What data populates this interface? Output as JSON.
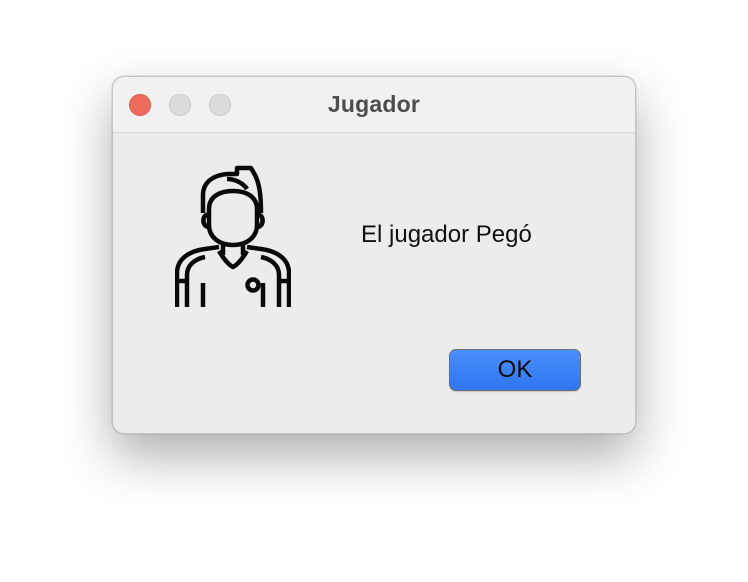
{
  "window": {
    "title": "Jugador"
  },
  "dialog": {
    "message": "El jugador Pegó",
    "icon": "football-player-icon",
    "ok_label": "OK"
  },
  "colors": {
    "close_button": "#ed6a5e",
    "inactive_buttons": "#dcdcdc",
    "accent_button": "#3b82f6",
    "window_background": "#ececec"
  }
}
